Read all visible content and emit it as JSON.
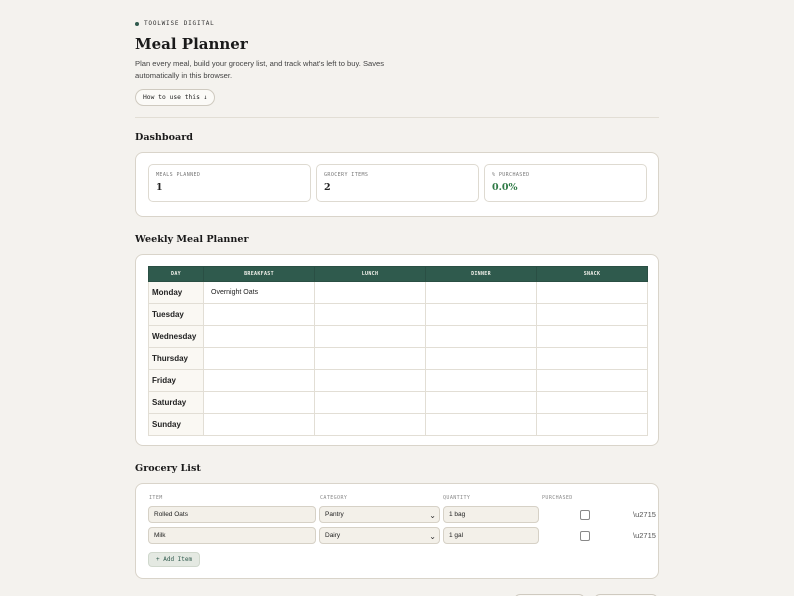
{
  "brand": {
    "name": "TOOLWISE DIGITAL"
  },
  "header": {
    "title": "Meal Planner",
    "subtitle": "Plan every meal, build your grocery list, and track what's left to buy. Saves automatically in this browser.",
    "howto_label": "How to use this ↓"
  },
  "dashboard": {
    "title": "Dashboard",
    "stats": [
      {
        "label": "MEALS PLANNED",
        "value": "1"
      },
      {
        "label": "GROCERY ITEMS",
        "value": "2"
      },
      {
        "label": "% PURCHASED",
        "value": "0.0%"
      }
    ]
  },
  "planner": {
    "title": "Weekly Meal Planner",
    "columns": [
      "DAY",
      "BREAKFAST",
      "LUNCH",
      "DINNER",
      "SNACK"
    ],
    "rows": [
      {
        "day": "Monday",
        "breakfast": "Overnight Oats",
        "lunch": "",
        "dinner": "",
        "snack": ""
      },
      {
        "day": "Tuesday",
        "breakfast": "",
        "lunch": "",
        "dinner": "",
        "snack": ""
      },
      {
        "day": "Wednesday",
        "breakfast": "",
        "lunch": "",
        "dinner": "",
        "snack": ""
      },
      {
        "day": "Thursday",
        "breakfast": "",
        "lunch": "",
        "dinner": "",
        "snack": ""
      },
      {
        "day": "Friday",
        "breakfast": "",
        "lunch": "",
        "dinner": "",
        "snack": ""
      },
      {
        "day": "Saturday",
        "breakfast": "",
        "lunch": "",
        "dinner": "",
        "snack": ""
      },
      {
        "day": "Sunday",
        "breakfast": "",
        "lunch": "",
        "dinner": "",
        "snack": ""
      }
    ]
  },
  "grocery": {
    "title": "Grocery List",
    "headers": {
      "item": "ITEM",
      "category": "CATEGORY",
      "quantity": "QUANTITY",
      "purchased": "PURCHASED"
    },
    "items": [
      {
        "item": "Rolled Oats",
        "category": "Pantry",
        "quantity": "1 bag",
        "purchased": false,
        "remove_label": "\\u2715"
      },
      {
        "item": "Milk",
        "category": "Dairy",
        "quantity": "1 gal",
        "purchased": false,
        "remove_label": "\\u2715"
      }
    ],
    "add_label": "+ Add Item"
  },
  "colors": {
    "accent": "#2f5a4d",
    "background": "#f4f2ee",
    "positive": "#2f7a46"
  }
}
